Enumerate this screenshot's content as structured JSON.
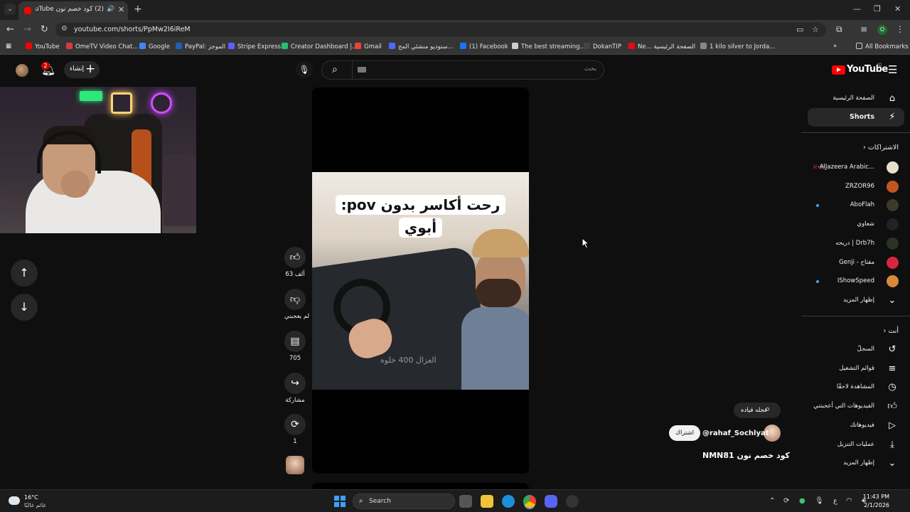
{
  "browser": {
    "tab_title": "(2) كود خصم نون NMN81 - YouTube",
    "tab_audio_icon": "speaker-icon",
    "url": "youtube.com/shorts/PpMw2I6iReM",
    "bookmarks": [
      {
        "label": "YouTube",
        "color": "#ff0000"
      },
      {
        "label": "OmeTV Video Chat...",
        "color": "#d83b3b"
      },
      {
        "label": "Google",
        "color": "#4285f4"
      },
      {
        "label": "PayPal: الموجز",
        "color": "#1f5fb8"
      },
      {
        "label": "Stripe Express",
        "color": "#635bff"
      },
      {
        "label": "Creator Dashboard |...",
        "color": "#21c46b"
      },
      {
        "label": "Gmail",
        "color": "#ea4335"
      },
      {
        "label": "ستوديو منشئي المح...",
        "color": "#4a6cf7"
      },
      {
        "label": "(1) Facebook",
        "color": "#1877f2"
      },
      {
        "label": "The best streaming...",
        "color": "#cccccc"
      },
      {
        "label": "DokanTIP",
        "color": "#444444"
      },
      {
        "label": "Ne... الصفحة الرئيسية",
        "color": "#e50914"
      },
      {
        "label": "1 kilo silver to Jorda...",
        "color": "#888888"
      }
    ],
    "all_bookmarks": "All Bookmarks",
    "profile_initial": "O"
  },
  "header": {
    "notification_count": "2",
    "create_label": "إنشاء",
    "search_placeholder": "بحث",
    "logo_text": "YouTube",
    "logo_country": "JO"
  },
  "short": {
    "caption_line1": "رحت أكاسر بدون pov:",
    "caption_line2": "أبوي",
    "watermark": "الغزال 400 خلوه",
    "likes": "63 ألف",
    "dislike_label": "لم يعجبني",
    "comments": "705",
    "share_label": "مشاركة",
    "remix_count": "1",
    "sound_chip": "عجله قياده",
    "channel": "@rahaf_Sochlyat",
    "subscribe": "اشتراك",
    "title": "كود خصم نون NMN81"
  },
  "sidebar": {
    "home": "الصفحة الرئيسية",
    "shorts": "Shorts",
    "subscriptions_heading": "الاشتراكات",
    "subscriptions": [
      {
        "name": "AlJazeera Arabic...",
        "live": true,
        "dot": false,
        "color": "#e8e0c8"
      },
      {
        "name": "ZRZOR96",
        "live": false,
        "dot": false,
        "color": "#c0561f"
      },
      {
        "name": "AboFlah",
        "live": false,
        "dot": true,
        "color": "#3b3b2a"
      },
      {
        "name": "شعاوي",
        "live": false,
        "dot": false,
        "color": "#222222"
      },
      {
        "name": "دريحه | Drb7h",
        "live": false,
        "dot": false,
        "color": "#2b3326"
      },
      {
        "name": "Genji - مفتاح",
        "live": false,
        "dot": false,
        "color": "#d7263d"
      },
      {
        "name": "IShowSpeed",
        "live": false,
        "dot": true,
        "color": "#d88a3a"
      }
    ],
    "show_more_1": "إظهار المزيد",
    "you_heading": "أنت",
    "you_items": [
      {
        "label": "السجلّ",
        "icon": "history-icon"
      },
      {
        "label": "قوائم التشغيل",
        "icon": "playlists-icon"
      },
      {
        "label": "المشاهدة لاحقًا",
        "icon": "watch-later-icon"
      },
      {
        "label": "الفيديوهات التي أعجبتني",
        "icon": "liked-videos-icon"
      },
      {
        "label": "فيديوهاتك",
        "icon": "your-videos-icon"
      },
      {
        "label": "عمليات التنزيل",
        "icon": "downloads-icon"
      }
    ],
    "show_more_2": "إظهار المزيد"
  },
  "taskbar": {
    "temperature": "16°C",
    "weather_desc": "غائم غالبًا",
    "search_label": "Search",
    "time": "11:43 PM",
    "date": "2/1/2026",
    "lang": "ع"
  }
}
